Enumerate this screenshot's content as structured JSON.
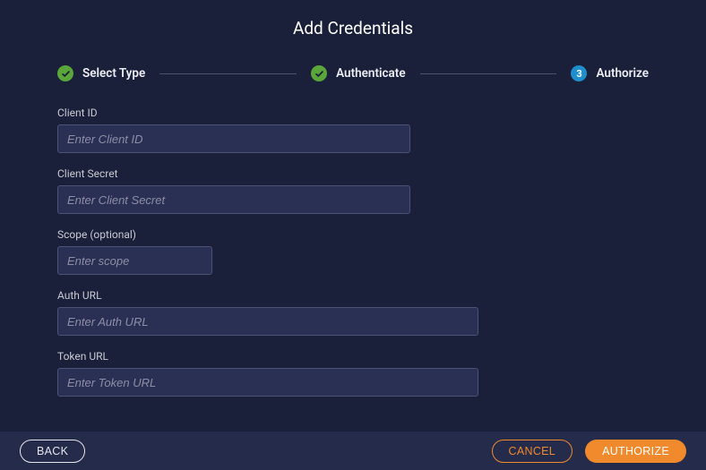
{
  "title": "Add Credentials",
  "stepper": {
    "steps": [
      {
        "label": "Select Type",
        "state": "done"
      },
      {
        "label": "Authenticate",
        "state": "done"
      },
      {
        "label": "Authorize",
        "state": "current",
        "number": "3"
      }
    ]
  },
  "form": {
    "client_id": {
      "label": "Client ID",
      "placeholder": "Enter Client ID",
      "value": ""
    },
    "client_secret": {
      "label": "Client Secret",
      "placeholder": "Enter Client Secret",
      "value": ""
    },
    "scope": {
      "label": "Scope (optional)",
      "placeholder": "Enter scope",
      "value": ""
    },
    "auth_url": {
      "label": "Auth URL",
      "placeholder": "Enter Auth URL",
      "value": ""
    },
    "token_url": {
      "label": "Token URL",
      "placeholder": "Enter Token URL",
      "value": ""
    }
  },
  "footer": {
    "back": "BACK",
    "cancel": "CANCEL",
    "authorize": "AUTHORIZE"
  }
}
